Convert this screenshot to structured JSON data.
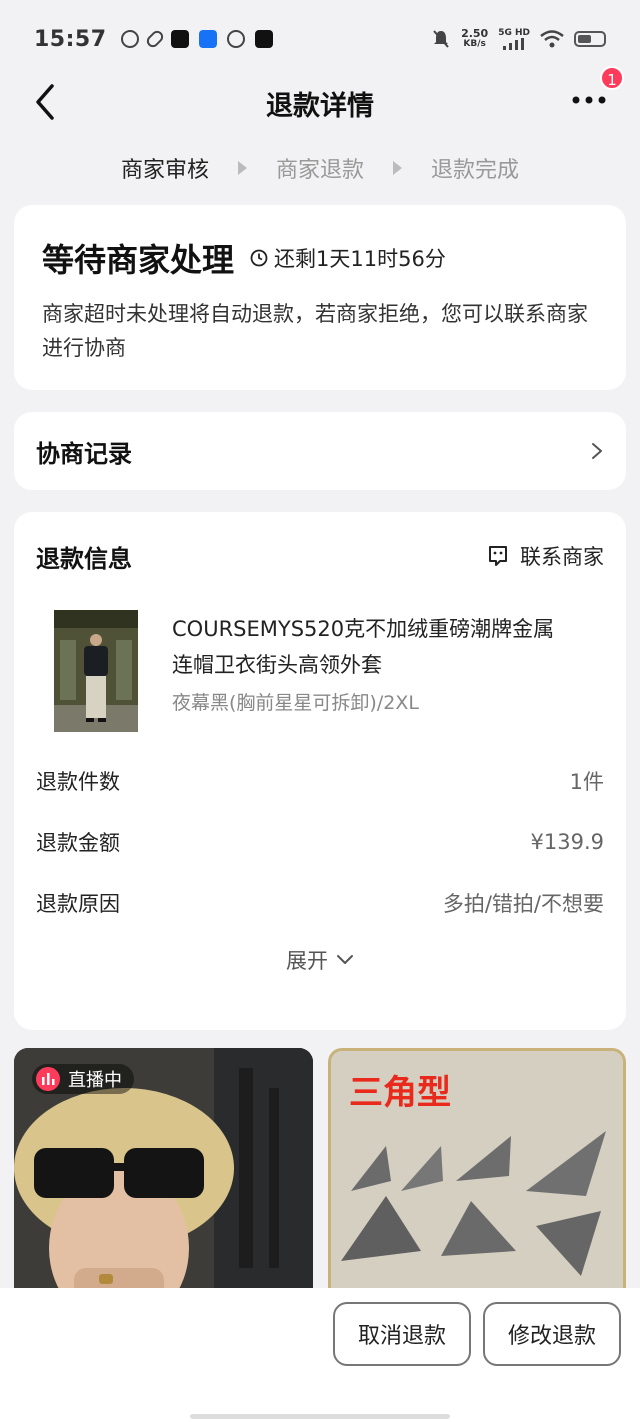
{
  "status_bar": {
    "time": "15:57",
    "net_speed_value": "2.50",
    "net_speed_unit": "KB/s",
    "network_type": "5G HD",
    "notif_apps": [
      "netease-music-icon",
      "link-icon",
      "news-icon",
      "zhihu-icon",
      "chat-icon",
      "douyin-icon"
    ]
  },
  "nav": {
    "title": "退款详情",
    "badge_count": "1"
  },
  "steps": [
    "商家审核",
    "商家退款",
    "退款完成"
  ],
  "status": {
    "title": "等待商家处理",
    "countdown": "还剩1天11时56分",
    "description": "商家超时未处理将自动退款，若商家拒绝，您可以联系商家进行协商"
  },
  "negotiation": {
    "title": "协商记录"
  },
  "refund_info": {
    "title": "退款信息",
    "contact_label": "联系商家",
    "product": {
      "name_line1": "COURSEMYS520克不加绒重磅潮牌金属",
      "name_line2": "连帽卫衣街头高领外套",
      "sku": "夜幕黑(胸前星星可拆卸)/2XL"
    },
    "rows": [
      {
        "label": "退款件数",
        "value": "1件"
      },
      {
        "label": "退款金额",
        "value": "¥139.9"
      },
      {
        "label": "退款原因",
        "value": "多拍/错拍/不想要"
      }
    ],
    "expand_label": "展开"
  },
  "feed": {
    "live_label": "直播中",
    "promo_text": "三角型"
  },
  "actions": {
    "cancel_label": "取消退款",
    "modify_label": "修改退款"
  }
}
